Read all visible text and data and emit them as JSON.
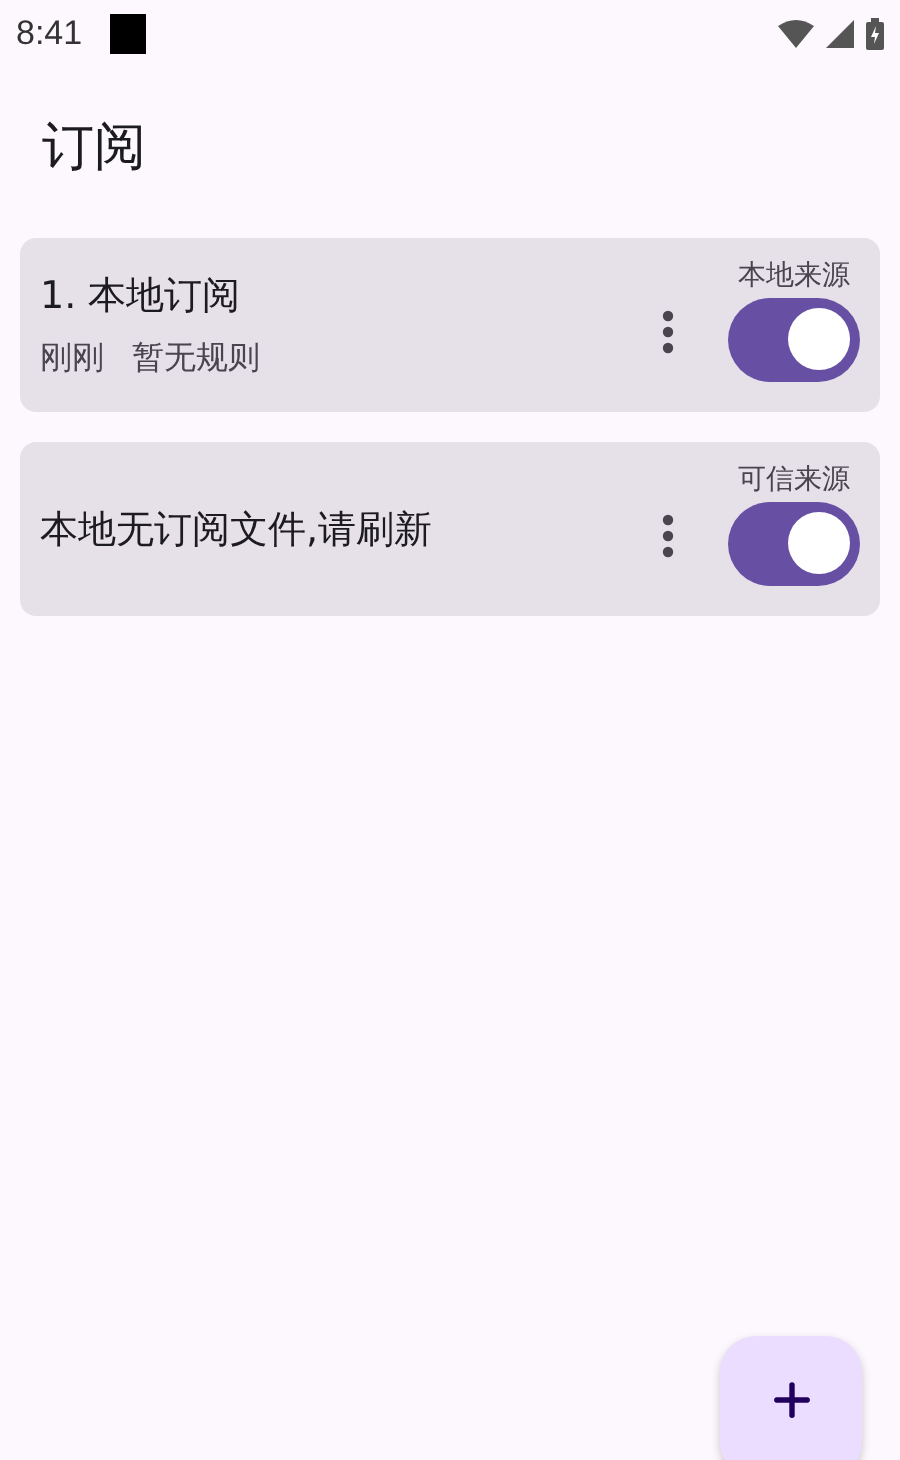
{
  "status_bar": {
    "time": "8:41"
  },
  "title": "订阅",
  "subscriptions": [
    {
      "kind": "entry",
      "title": "1. 本地订阅",
      "meta": [
        "刚刚",
        "暂无规则"
      ],
      "switch_label": "本地来源",
      "on": true
    },
    {
      "kind": "message",
      "title": "本地无订阅文件,请刷新",
      "switch_label": "可信来源",
      "on": true
    }
  ]
}
